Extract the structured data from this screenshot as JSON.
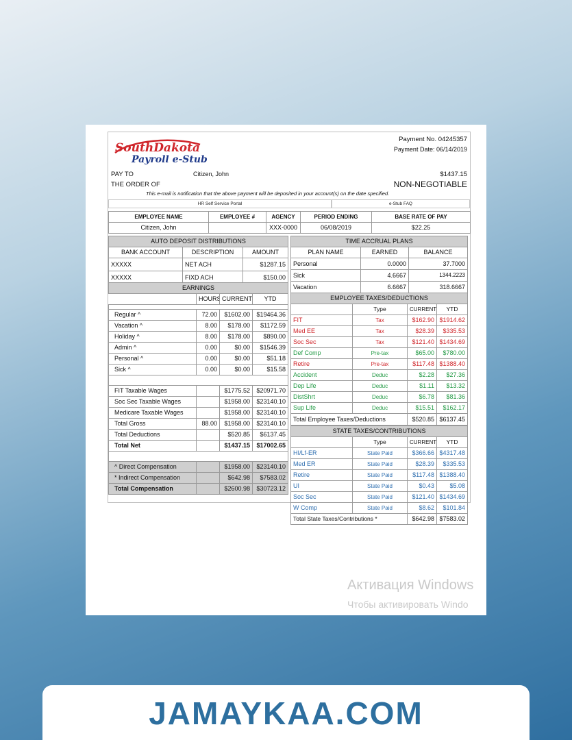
{
  "header": {
    "logo_line1": "SouthDakota",
    "logo_line2": "Payroll e-Stub",
    "payment_no": "Payment No. 04245357",
    "payment_date": "Payment Date: 06/14/2019",
    "pay_to": "PAY TO",
    "order_of": "THE ORDER OF",
    "payee": "Citizen,   John",
    "amount": "$1437.15",
    "non_negotiable": "NON-NEGOTIABLE",
    "notice": "This e-mail is notification that the above payment will be deposited in your account(s) on the date specified.",
    "link_portal": "HR Self Service Portal",
    "link_faq": "e-Stub FAQ"
  },
  "employee": {
    "headers": [
      "EMPLOYEE NAME",
      "EMPLOYEE #",
      "AGENCY",
      "PERIOD ENDING",
      "BASE RATE OF PAY"
    ],
    "values": [
      "Citizen,  John",
      "",
      "XXX-0000",
      "06/08/2019",
      "$22.25"
    ]
  },
  "auto_deposit": {
    "title": "AUTO DEPOSIT DISTRIBUTIONS",
    "headers": [
      "BANK ACCOUNT",
      "DESCRIPTION",
      "AMOUNT"
    ],
    "rows": [
      [
        "XXXXX",
        "NET ACH",
        "$1287.15"
      ],
      [
        "XXXXX",
        "FIXD ACH",
        "$150.00"
      ]
    ]
  },
  "earnings": {
    "title": "EARNINGS",
    "headers": [
      "",
      "HOURS",
      "CURRENT",
      "YTD"
    ],
    "rows": [
      [
        "Regular ^",
        "72.00",
        "$1602.00",
        "$19464.36"
      ],
      [
        "Vacation ^",
        "8.00",
        "$178.00",
        "$1172.59"
      ],
      [
        "Holiday ^",
        "8.00",
        "$178.00",
        "$890.00"
      ],
      [
        "Admin ^",
        "0.00",
        "$0.00",
        "$1546.39"
      ],
      [
        "Personal ^",
        "0.00",
        "$0.00",
        "$51.18"
      ],
      [
        "Sick ^",
        "0.00",
        "$0.00",
        "$15.58"
      ]
    ],
    "wages": [
      [
        "FIT Taxable Wages",
        "",
        "$1775.52",
        "$20971.70"
      ],
      [
        "Soc Sec Taxable Wages",
        "",
        "$1958.00",
        "$23140.10"
      ],
      [
        "Medicare Taxable Wages",
        "",
        "$1958.00",
        "$23140.10"
      ],
      [
        "Total Gross",
        "88.00",
        "$1958.00",
        "$23140.10"
      ],
      [
        "Total Deductions",
        "",
        "$520.85",
        "$6137.45"
      ],
      [
        "Total Net",
        "",
        "$1437.15",
        "$17002.65"
      ]
    ],
    "comp": [
      [
        "^ Direct Compensation",
        "",
        "$1958.00",
        "$23140.10"
      ],
      [
        "* Indirect Compensation",
        "",
        "$642.98",
        "$7583.02"
      ],
      [
        "Total Compensation",
        "",
        "$2600.98",
        "$30723.12"
      ]
    ]
  },
  "accrual": {
    "title": "TIME ACCRUAL PLANS",
    "headers": [
      "PLAN NAME",
      "EARNED",
      "BALANCE"
    ],
    "rows": [
      [
        "Personal",
        "0.0000",
        "37.7000"
      ],
      [
        "Sick",
        "4.6667",
        "1344.2223"
      ],
      [
        "Vacation",
        "6.6667",
        "318.6667"
      ]
    ]
  },
  "employee_taxes": {
    "title": "EMPLOYEE TAXES/DEDUCTIONS",
    "headers": [
      "",
      "Type",
      "CURRENT",
      "YTD"
    ],
    "rows": [
      [
        "FIT",
        "Tax",
        "$162.90",
        "$1914.62"
      ],
      [
        "Med EE",
        "Tax",
        "$28.39",
        "$335.53"
      ],
      [
        "Soc Sec",
        "Tax",
        "$121.40",
        "$1434.69"
      ],
      [
        "Def Comp",
        "Pre-tax",
        "$65.00",
        "$780.00"
      ],
      [
        "Retire",
        "Pre-tax",
        "$117.48",
        "$1388.40"
      ],
      [
        "Accident",
        "Deduc",
        "$2.28",
        "$27.36"
      ],
      [
        "Dep Life",
        "Deduc",
        "$1.11",
        "$13.32"
      ],
      [
        "DistShrt",
        "Deduc",
        "$6.78",
        "$81.36"
      ],
      [
        "Sup Life",
        "Deduc",
        "$15.51",
        "$162.17"
      ]
    ],
    "total": [
      "Total Employee Taxes/Deductions",
      "$520.85",
      "$6137.45"
    ]
  },
  "state_taxes": {
    "title": "STATE TAXES/CONTRIBUTIONS",
    "headers": [
      "",
      "Type",
      "CURRENT",
      "YTD"
    ],
    "rows": [
      [
        "HI/Lf-ER",
        "State Paid",
        "$366.66",
        "$4317.48"
      ],
      [
        "Med ER",
        "State Paid",
        "$28.39",
        "$335.53"
      ],
      [
        "Retire",
        "State Paid",
        "$117.48",
        "$1388.40"
      ],
      [
        "UI",
        "State Paid",
        "$0.43",
        "$5.08"
      ],
      [
        "Soc Sec",
        "State Paid",
        "$121.40",
        "$1434.69"
      ],
      [
        "W Comp",
        "State Paid",
        "$8.62",
        "$101.84"
      ]
    ],
    "total": [
      "Total State Taxes/Contributions *",
      "$642.98",
      "$7583.02"
    ]
  },
  "watermark": {
    "line1": "Активация Windows",
    "line2": "Чтобы активировать Windo"
  },
  "banner": {
    "text": "JAMAYKAA.COM"
  },
  "colors": {
    "tax_red": "#d0262b",
    "deduction_green": "#239a45",
    "state_blue": "#2f6fb0",
    "banner_blue": "#2d6f9f",
    "logo_red": "#d0262b",
    "logo_blue": "#1f3a8a"
  }
}
